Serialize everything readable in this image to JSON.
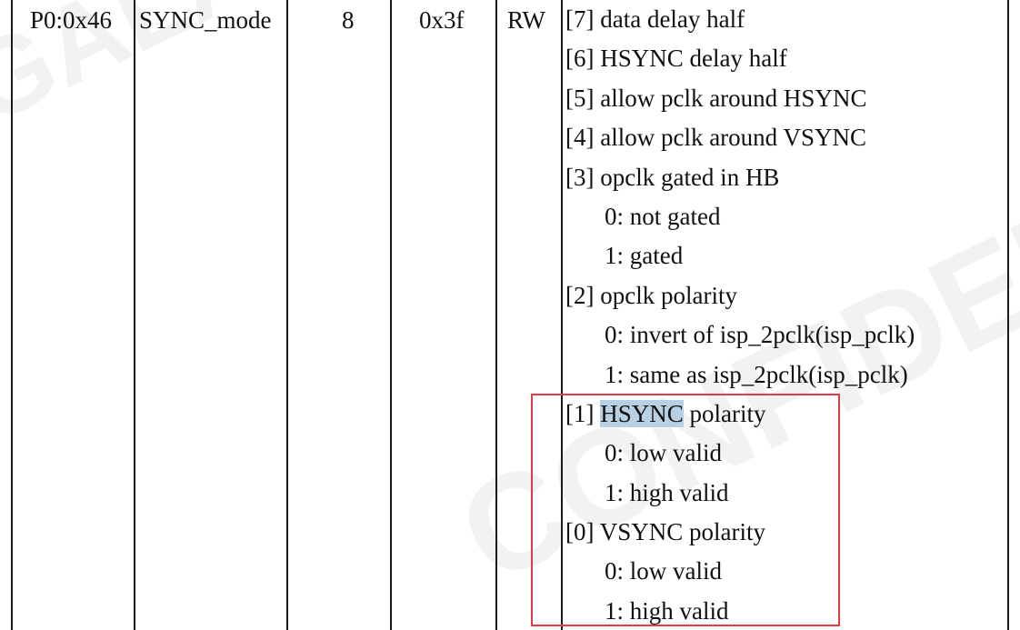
{
  "row": {
    "address": "P0:0x46",
    "name": "SYNC_mode",
    "width": "8",
    "default": "0x3f",
    "access": "RW"
  },
  "description": [
    {
      "text": "[7] data delay half",
      "indent": false
    },
    {
      "text": "[6] HSYNC delay half",
      "indent": false
    },
    {
      "text": "[5] allow pclk around HSYNC",
      "indent": false
    },
    {
      "text": "[4] allow pclk around VSYNC",
      "indent": false
    },
    {
      "text": "[3] opclk gated in HB",
      "indent": false
    },
    {
      "text": "0: not gated",
      "indent": true
    },
    {
      "text": "1: gated",
      "indent": true
    },
    {
      "text": "[2] opclk polarity",
      "indent": false
    },
    {
      "text": "0: invert of isp_2pclk(isp_pclk)",
      "indent": true
    },
    {
      "text": "1: same as isp_2pclk(isp_pclk)",
      "indent": true
    },
    {
      "text_prefix": "[1] ",
      "text_highlight": "HSYNC",
      "text_suffix": " polarity",
      "indent": false
    },
    {
      "text": "0: low valid",
      "indent": true
    },
    {
      "text": "1: high valid",
      "indent": true
    },
    {
      "text": "[0] VSYNC polarity",
      "indent": false
    },
    {
      "text": "0: low valid",
      "indent": true
    },
    {
      "text": "1: high valid",
      "indent": true
    }
  ],
  "watermark": {
    "top_left": "GALAXYCORE",
    "bottom_right": "CONFIDENTIAL"
  },
  "colors": {
    "highlight": "#b7d0e4",
    "annotation_box": "#e03c46",
    "border": "#1a1a1a"
  }
}
